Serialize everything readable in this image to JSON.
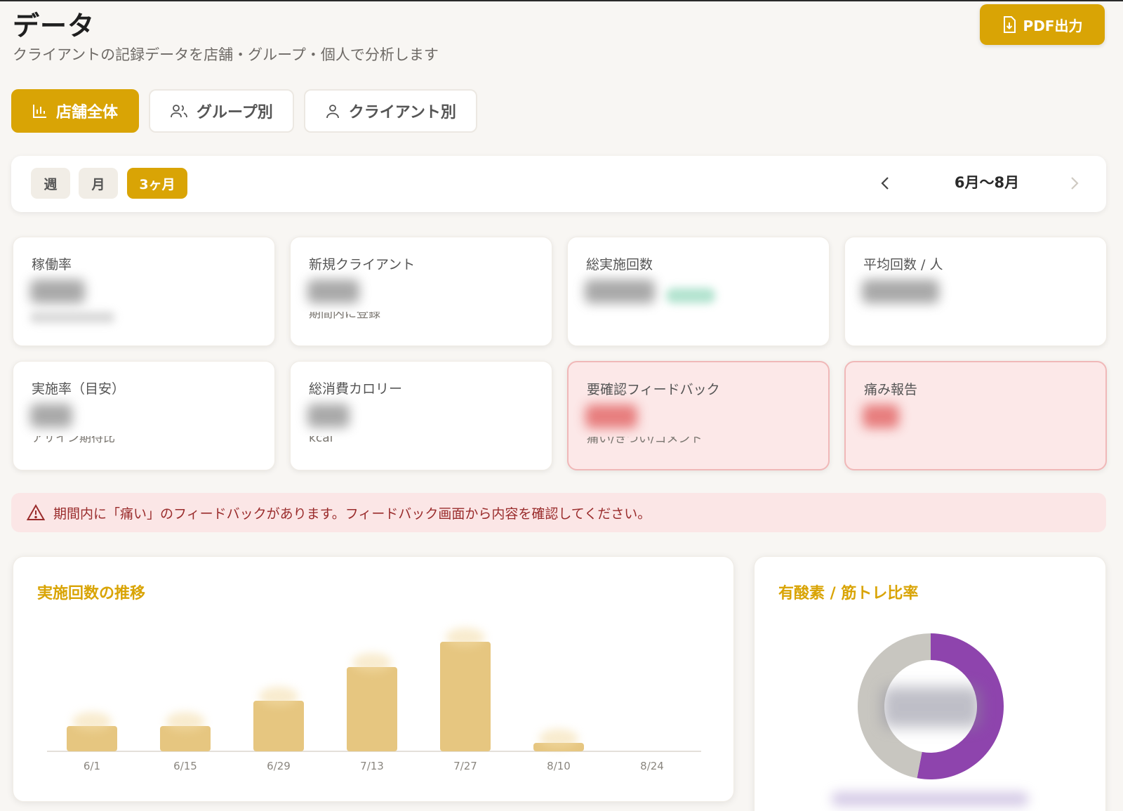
{
  "header": {
    "title": "データ",
    "subtitle": "クライアントの記録データを店舗・グループ・個人で分析します",
    "pdf_label": "PDF出力"
  },
  "tabs": [
    {
      "label": "店舗全体",
      "icon": "bar-chart-icon",
      "active": true
    },
    {
      "label": "グループ別",
      "icon": "users-icon",
      "active": false
    },
    {
      "label": "クライアント別",
      "icon": "user-icon",
      "active": false
    }
  ],
  "period": {
    "options": [
      {
        "label": "週",
        "active": false
      },
      {
        "label": "月",
        "active": false
      },
      {
        "label": "3ヶ月",
        "active": true
      }
    ],
    "range": "6月〜8月"
  },
  "kpi_cards": [
    {
      "label": "稼働率",
      "sub": "",
      "alert": false
    },
    {
      "label": "新規クライアント",
      "sub": "期間内に登録",
      "alert": false
    },
    {
      "label": "総実施回数",
      "sub": "",
      "alert": false
    },
    {
      "label": "平均回数 / 人",
      "sub": "",
      "alert": false
    },
    {
      "label": "実施率（目安）",
      "sub": "アサイン期待比",
      "alert": false
    },
    {
      "label": "総消費カロリー",
      "sub": "kcal",
      "alert": false
    },
    {
      "label": "要確認フィードバック",
      "sub": "痛い/きつい/コメント",
      "alert": true
    },
    {
      "label": "痛み報告",
      "sub": "",
      "alert": true
    }
  ],
  "warning": {
    "text": "期間内に「痛い」のフィードバックがあります。フィードバック画面から内容を確認してください。"
  },
  "trend_panel": {
    "title": "実施回数の推移"
  },
  "ratio_panel": {
    "title": "有酸素 / 筋トレ比率"
  },
  "colors": {
    "accent": "#d9a405",
    "bar": "#e6c680",
    "donut_purple": "#8e44ad",
    "donut_gray": "#c8c6c0",
    "alert_bg": "#fce8e8"
  },
  "chart_data": [
    {
      "type": "bar",
      "categories": [
        "6/1",
        "6/15",
        "6/29",
        "7/13",
        "7/27",
        "8/10",
        "8/24"
      ],
      "values": [
        3,
        3,
        6,
        10,
        13,
        1,
        0
      ],
      "ylim": [
        0,
        15
      ],
      "title": "実施回数の推移"
    },
    {
      "type": "pie",
      "labels": [],
      "values": [
        53,
        47
      ],
      "colors": [
        "#8e44ad",
        "#c8c6c0"
      ],
      "title": "有酸素 / 筋トレ比率"
    }
  ]
}
